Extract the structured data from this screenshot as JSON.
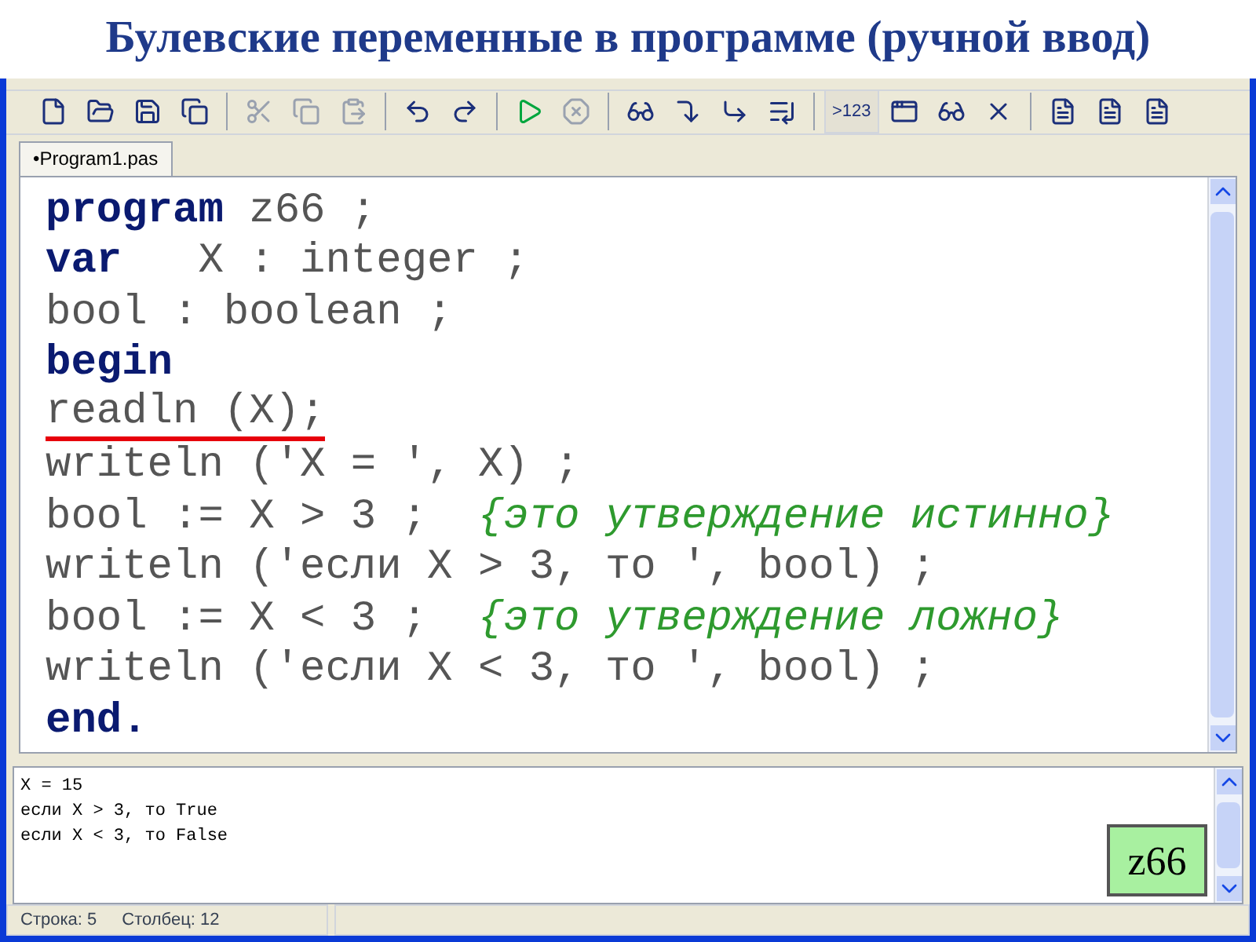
{
  "slide_title": "Булевские переменные в программе (ручной ввод)",
  "toolbar": [
    {
      "kind": "new",
      "disabled": false
    },
    {
      "kind": "open",
      "disabled": false
    },
    {
      "kind": "save",
      "disabled": false
    },
    {
      "kind": "saveall",
      "disabled": false
    },
    {
      "kind": "sep"
    },
    {
      "kind": "cut",
      "disabled": true
    },
    {
      "kind": "copy",
      "disabled": true
    },
    {
      "kind": "paste",
      "disabled": true
    },
    {
      "kind": "sep"
    },
    {
      "kind": "undo",
      "disabled": false
    },
    {
      "kind": "redo",
      "disabled": false
    },
    {
      "kind": "sep"
    },
    {
      "kind": "run",
      "disabled": false
    },
    {
      "kind": "stop",
      "disabled": true
    },
    {
      "kind": "sep"
    },
    {
      "kind": "watch",
      "disabled": false
    },
    {
      "kind": "stepin",
      "disabled": false
    },
    {
      "kind": "stepover",
      "disabled": false
    },
    {
      "kind": "tocursor",
      "disabled": false
    },
    {
      "kind": "sep"
    },
    {
      "kind": "text",
      "label": ">123",
      "disabled": false
    },
    {
      "kind": "window",
      "disabled": false
    },
    {
      "kind": "glasses",
      "disabled": false
    },
    {
      "kind": "close",
      "disabled": false
    },
    {
      "kind": "sep"
    },
    {
      "kind": "doc",
      "disabled": false
    },
    {
      "kind": "doc",
      "disabled": false
    },
    {
      "kind": "doc",
      "disabled": false
    }
  ],
  "tabs": [
    {
      "label": "•Program1.pas",
      "selected": true
    }
  ],
  "code_lines": [
    {
      "underlined": false,
      "segments": [
        {
          "kind": "keyword",
          "text": "program"
        },
        {
          "kind": "plain",
          "text": " z66 ;"
        }
      ]
    },
    {
      "underlined": false,
      "segments": [
        {
          "kind": "keyword",
          "text": "var"
        },
        {
          "kind": "plain",
          "text": "   X : integer ;"
        }
      ]
    },
    {
      "underlined": false,
      "segments": [
        {
          "kind": "plain",
          "text": "bool : boolean ;"
        }
      ]
    },
    {
      "underlined": false,
      "segments": [
        {
          "kind": "keyword",
          "text": "begin"
        }
      ]
    },
    {
      "underlined": true,
      "segments": [
        {
          "kind": "plain",
          "text": "readln (X);"
        }
      ]
    },
    {
      "underlined": false,
      "segments": [
        {
          "kind": "plain",
          "text": "writeln ('X = ', X) ;"
        }
      ]
    },
    {
      "underlined": false,
      "segments": [
        {
          "kind": "plain",
          "text": "bool := X > 3 ;  "
        },
        {
          "kind": "comment",
          "text": "{это утверждение истинно}"
        }
      ]
    },
    {
      "underlined": false,
      "segments": [
        {
          "kind": "plain",
          "text": "writeln ('если X > 3, то ', bool) ;"
        }
      ]
    },
    {
      "underlined": false,
      "segments": [
        {
          "kind": "plain",
          "text": "bool := X < 3 ;  "
        },
        {
          "kind": "comment",
          "text": "{это утверждение ложно}"
        }
      ]
    },
    {
      "underlined": false,
      "segments": [
        {
          "kind": "plain",
          "text": "writeln ('если X < 3, то ', bool) ;"
        }
      ]
    },
    {
      "underlined": false,
      "segments": [
        {
          "kind": "keyword",
          "text": "end."
        }
      ]
    }
  ],
  "output_lines": [
    "X = 15",
    "если X > 3, то True",
    "если X < 3, то False"
  ],
  "badge": "z66",
  "status_bar": {
    "line": "Строка: 5",
    "column": "Столбец: 12"
  }
}
